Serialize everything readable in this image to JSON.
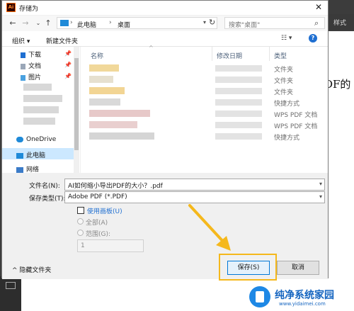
{
  "window": {
    "title": "存储为",
    "app_icon": "Ai",
    "close": "✕"
  },
  "nav": {
    "back": "←",
    "forward": "→",
    "recent": "⌄",
    "up": "↑",
    "breadcrumb": [
      "此电脑",
      "桌面"
    ],
    "separator": "›",
    "refresh": "↻",
    "search_placeholder": "搜索\"桌面\""
  },
  "toolbar": {
    "organize": "组织 ▾",
    "new_folder": "新建文件夹",
    "view": "☷ ▾",
    "help": "?"
  },
  "sidebar": {
    "items": [
      {
        "label": "下载",
        "icon": "download-icon"
      },
      {
        "label": "文档",
        "icon": "document-icon"
      },
      {
        "label": "图片",
        "icon": "picture-icon"
      },
      {
        "label": "OneDrive",
        "icon": "cloud-icon"
      },
      {
        "label": "此电脑",
        "icon": "computer-icon"
      },
      {
        "label": "网络",
        "icon": "network-icon"
      }
    ]
  },
  "files": {
    "columns": [
      "名称",
      "修改日期",
      "类型"
    ],
    "types": [
      "文件夹",
      "文件夹",
      "文件夹",
      "快捷方式",
      "WPS PDF 文档",
      "WPS PDF 文档",
      "快捷方式"
    ]
  },
  "form": {
    "filename_label": "文件名(N):",
    "filename_value": "AI如何缩小导出PDF的大小？.pdf",
    "type_label": "保存类型(T):",
    "type_value": "Adobe PDF (*.PDF)",
    "use_artboards": "使用画板(U)",
    "all": "全部(A)",
    "range": "范围(G):",
    "range_value": "1",
    "hide_folders": "隐藏文件夹",
    "save": "保存(S)",
    "cancel": "取消"
  },
  "background": {
    "toolbar_label": "样式",
    "doc_text": "DF的"
  },
  "watermark": {
    "text": "纯净系统家园",
    "url": "www.yidaimei.com"
  },
  "colors": {
    "accent": "#0078d7",
    "highlight": "#f5b81c",
    "link": "#1f6fd1"
  }
}
